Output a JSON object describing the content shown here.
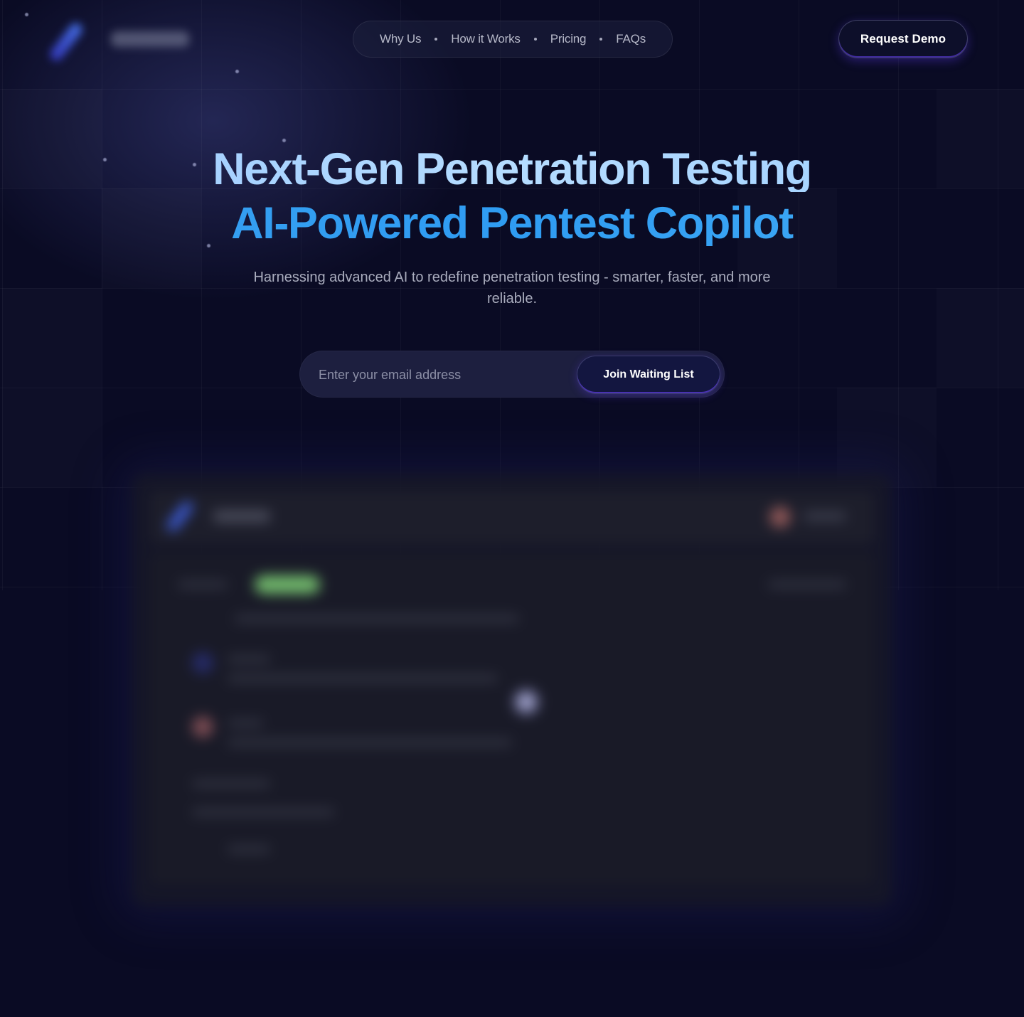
{
  "nav": {
    "items": [
      {
        "label": "Why Us"
      },
      {
        "label": "How it Works"
      },
      {
        "label": "Pricing"
      },
      {
        "label": "FAQs"
      }
    ]
  },
  "header": {
    "cta_label": "Request Demo"
  },
  "hero": {
    "title_line1": "Next-Gen Penetration Testing",
    "title_line2": "AI-Powered Pentest Copilot",
    "subtitle": "Harnessing advanced AI to redefine penetration testing - smarter, faster, and more reliable."
  },
  "signup": {
    "placeholder": "Enter your email address",
    "button_label": "Join Waiting List"
  },
  "colors": {
    "background": "#0a0b24",
    "title_light": "#a8d4ff",
    "title_accent": "#3aa4f3",
    "button_glow": "#6e46ff",
    "preview_tag": "#6fb56a"
  },
  "icons": {
    "logo": "brand-logo-icon"
  }
}
